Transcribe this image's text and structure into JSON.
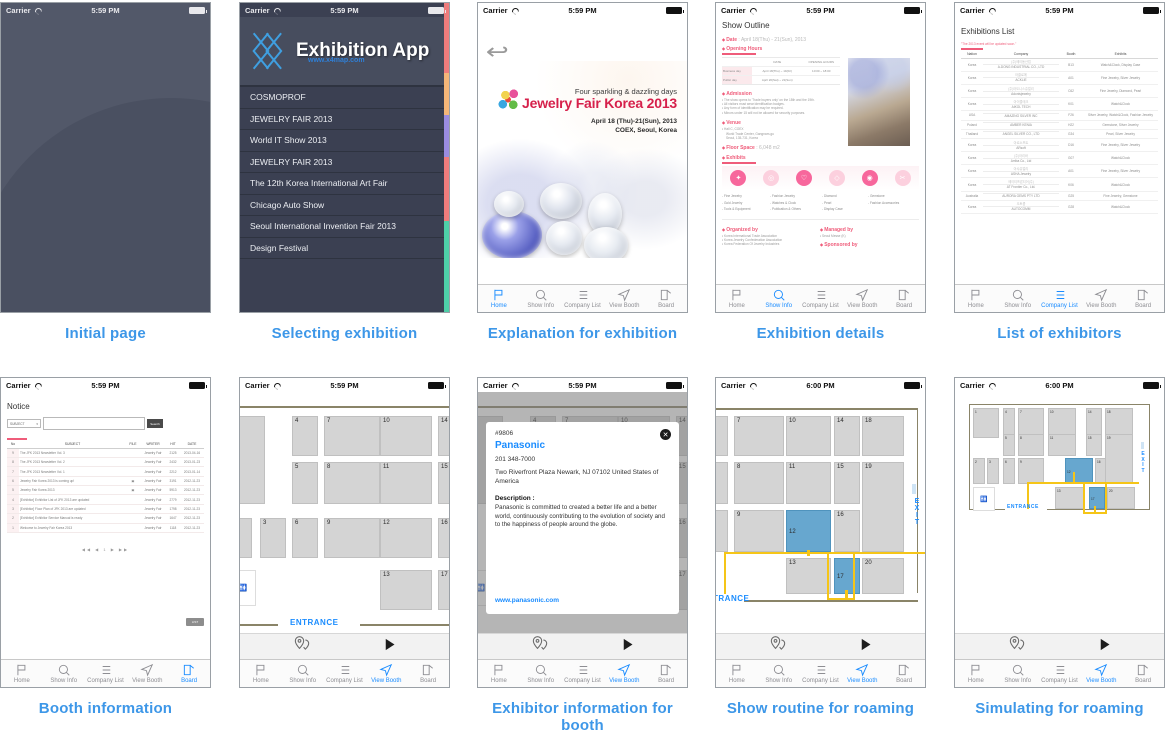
{
  "status_bar": {
    "carrier": "Carrier",
    "time_559": "5:59 PM",
    "time_600": "6:00 PM"
  },
  "tabs": [
    {
      "label": "Home",
      "icon": "flag-icon"
    },
    {
      "label": "Show Info",
      "icon": "search-icon"
    },
    {
      "label": "Company List",
      "icon": "list-icon"
    },
    {
      "label": "View Booth",
      "icon": "navigation-arrow-icon"
    },
    {
      "label": "Board",
      "icon": "compose-icon"
    }
  ],
  "panels": [
    {
      "caption": "Initial page"
    },
    {
      "caption": "Selecting exhibition"
    },
    {
      "caption": "Explanation for exhibition"
    },
    {
      "caption": "Exhibition details"
    },
    {
      "caption": "List of exhibitors"
    },
    {
      "caption": "Booth information"
    },
    {
      "caption": ""
    },
    {
      "caption": "Exhibitor information for booth"
    },
    {
      "caption": "Show routine for roaming"
    },
    {
      "caption": "Simulating for roaming"
    }
  ],
  "splash": {
    "title_line1": "Exhibition",
    "title_line2": "App",
    "website": "www.x4map.com"
  },
  "exhibition_list": {
    "header_title": "Exhibition App",
    "header_sub": "www.x4map.com",
    "items": [
      "COSMOPROF",
      "JEWELRY FAIR 2013",
      "World IT Show 2013",
      "JEWELRY FAIR 2013",
      "The 12th Korea International Art Fair",
      "Chicago Auto Show",
      "Seoul International Invention Fair 2013",
      "Design Festival"
    ],
    "scroll_colors": [
      "#ef7c7c",
      "#f5b678",
      "#9b8ce0",
      "#ef7c7c",
      "#4ecfa8"
    ]
  },
  "poster": {
    "tagline": "Four sparkling & dazzling days",
    "title": "Jewelry Fair Korea 2013",
    "dates": "April 18 (Thu)-21(Sun), 2013",
    "venue": "COEX, Seoul, Korea",
    "back_icon": "back-arrow-icon"
  },
  "show_outline": {
    "title": "Show Outline",
    "sections": [
      {
        "label": "Date",
        "value": "April 18(Thu) - 21(Sun), 2013"
      },
      {
        "label": "Opening Hours",
        "value": ""
      },
      {
        "label": "Admission",
        "value": ""
      },
      {
        "label": "Venue",
        "value": ""
      },
      {
        "label": "Floor Space",
        "value": "6,048 m2"
      },
      {
        "label": "Exhibits",
        "value": ""
      },
      {
        "label": "Organized by",
        "value": ""
      },
      {
        "label": "Managed by",
        "value": ""
      },
      {
        "label": "Sponsored by",
        "value": ""
      }
    ],
    "hours_table": {
      "headers": [
        "DATE",
        "OPENING HOURS"
      ],
      "rows": [
        [
          "Business day",
          "April 18(Thu) ~ 19(Fri)",
          "10:00 ~ 18:00"
        ],
        [
          "Public day",
          "April 20(Sat) ~ 21(Sun)",
          ""
        ]
      ]
    },
    "admission_bullets": [
      "The show opens to 'Trade buyers only' on the 18th and the 19th.",
      "All visitors must wear identification badges.",
      "Any form of identification may be required.",
      "Minors under 15 will not be allowed for security purposes."
    ],
    "venue_lines": [
      "Hall C, COEX",
      "World Trade Center, Gangnam-gu",
      "Seoul, 135-731, Korea"
    ],
    "exhibit_categories": [
      "Fine Jewelry",
      "Fashion Jewelry",
      "Diamond",
      "Gemstone",
      "Gold Jewelry",
      "Watches & Clock",
      "Pearl",
      "Fashion Accessories",
      "Tools & Equipment",
      "Publication & Others",
      "Display Case"
    ],
    "organizers": [
      "Korea International Trade Association",
      "Korea Jewelry Confederation Association",
      "Korea Federation Of Jewelry Industries"
    ],
    "managers": [
      "Seoul Messe (K)"
    ]
  },
  "exhibitors": {
    "title": "Exhibitions List",
    "note": "\"The 2013 event will be updated soon.\"",
    "headers": [
      "Nation",
      "Company",
      "Booth",
      "Exhibits"
    ],
    "rows": [
      {
        "nation": "Korea",
        "ko": "(주)에이동산업",
        "company": "A-DONG INDUSTRIAL CO., LTD",
        "booth": "B13",
        "exhibits": "Watch&Clock, Display Case"
      },
      {
        "nation": "Korea",
        "ko": "아클로에",
        "company": "ACKLIE",
        "booth": "A01",
        "exhibits": "Fine Jewelry, Silver Jewelry"
      },
      {
        "nation": "Korea",
        "ko": "(주)아도니스쥬얼리",
        "company": "Adonisjewelry",
        "booth": "C62",
        "exhibits": "Fine Jewelry, Diamond, Pearl"
      },
      {
        "nation": "Korea",
        "ko": "아이콜테크",
        "company": "AIKOL TECH",
        "booth": "K01",
        "exhibits": "Watch&Clock"
      },
      {
        "nation": "USA",
        "ko": "",
        "company": "AMAZING SILVER INC",
        "booth": "F26",
        "exhibits": "Silver Jewelry, Watch&Clock, Fashion Jewelry"
      },
      {
        "nation": "Poland",
        "ko": "",
        "company": "AMBER KENIA",
        "booth": "H22",
        "exhibits": "Gemstone, Silver Jewelry"
      },
      {
        "nation": "Thailand",
        "ko": "",
        "company": "ANGEL SILVER CO., LTD",
        "booth": "G34",
        "exhibits": "Pearl, Silver Jewelry"
      },
      {
        "nation": "Korea",
        "ko": "아르소프트",
        "company": "ARsoft",
        "booth": "D16",
        "exhibits": "Fine Jewelry, Silver Jewelry"
      },
      {
        "nation": "Korea",
        "ko": "(주)아리바",
        "company": "Arriba Co., Ltd",
        "booth": "G07",
        "exhibits": "Watch&Clock"
      },
      {
        "nation": "Korea",
        "ko": "아샤쥬얼리",
        "company": "ASHA Jewelry",
        "booth": "A01",
        "exhibits": "Fine Jewelry, Silver Jewelry"
      },
      {
        "nation": "Korea",
        "ko": "에이티프론티어(주)",
        "company": "AT Frontier Co., Ltd.",
        "booth": "K06",
        "exhibits": "Watch&Clock"
      },
      {
        "nation": "Australia",
        "ko": "",
        "company": "AURORA GEMS PTY LTD",
        "booth": "G25",
        "exhibits": "Fine Jewelry, Gemstone"
      },
      {
        "nation": "Korea",
        "ko": "오토콤",
        "company": "AUTOCOMM",
        "booth": "G28",
        "exhibits": "Watch&Clock"
      }
    ]
  },
  "notice": {
    "title": "Notice",
    "search_select": "SUBJECT",
    "search_value": "",
    "search_button": "Search",
    "headers": [
      "No",
      "SUBJECT",
      "FILE",
      "WRITER",
      "HIT",
      "DATE"
    ],
    "rows": [
      {
        "no": "9",
        "subject": "The JFK 2013 Newsletter Vol. 3",
        "file": "",
        "writer": "Jewelry Fair",
        "hit": "2125",
        "date": "2013-04-16"
      },
      {
        "no": "8",
        "subject": "The JFK 2013 Newsletter Vol. 2",
        "file": "",
        "writer": "Jewelry Fair",
        "hit": "2432",
        "date": "2013-01-23"
      },
      {
        "no": "7",
        "subject": "The JFK 2013 Newsletter Vol. 1",
        "file": "",
        "writer": "Jewelry Fair",
        "hit": "2212",
        "date": "2013-01-14"
      },
      {
        "no": "6",
        "subject": "Jewelry Fair Korea 2013 is coming up!",
        "file": "attachment-icon",
        "writer": "Jewelry Fair",
        "hit": "3191",
        "date": "2012-11-23"
      },
      {
        "no": "5",
        "subject": "Jewelry Fair Korea 2013",
        "file": "attachment-icon",
        "writer": "Jewelry Fair",
        "hit": "5913",
        "date": "2012-11-23"
      },
      {
        "no": "4",
        "subject": "[Exhibitor] Exhibitor List of JFK 2013 are updated",
        "file": "",
        "writer": "Jewelry Fair",
        "hit": "2779",
        "date": "2012-11-23"
      },
      {
        "no": "3",
        "subject": "[Exhibitor] Floor Plan of JFK 2013 are updated",
        "file": "",
        "writer": "Jewelry Fair",
        "hit": "1798",
        "date": "2012-11-23"
      },
      {
        "no": "2",
        "subject": "[Exhibitor] Exhibitor Service Manual is ready",
        "file": "",
        "writer": "Jewelry Fair",
        "hit": "1647",
        "date": "2012-11-23"
      },
      {
        "no": "1",
        "subject": "Welcome to Jewelry Fair Korea 2013",
        "file": "",
        "writer": "Jewelry Fair",
        "hit": "1118",
        "date": "2012-11-23"
      }
    ],
    "pager": "◀◀ ◀ 1 ▶ ▶▶",
    "list_button": "LIST"
  },
  "booth_popup": {
    "number": "#9806",
    "name": "Panasonic",
    "phone": "201 348-7000",
    "address": "Two Riverfront Plaza Newark, NJ 07102 United States of America",
    "description_label": "Description :",
    "description": "Panasonic is committed to created a better life and a better world, continuously contributing to the evolution of society and to the happiness of people around the globe.",
    "website": "www.panasonic.com",
    "close_icon": "close-icon"
  },
  "map": {
    "entrance_label": "ENTRANCE",
    "entrance_label_partial": "TRANCE",
    "exit_label": "EXIT",
    "selected_booths": [
      "12",
      "17"
    ],
    "route_color": "#f5c518",
    "selected_color": "#67a7cf",
    "booth_numbers_zoomed": [
      "3",
      "4",
      "5",
      "6",
      "7",
      "8",
      "9",
      "10",
      "11",
      "12",
      "13",
      "14",
      "15",
      "16",
      "17"
    ],
    "booth_numbers_full": [
      "1",
      "2",
      "3",
      "4",
      "5",
      "6",
      "7",
      "8",
      "9",
      "10",
      "11",
      "12",
      "13",
      "14",
      "15",
      "16",
      "17",
      "18",
      "19",
      "20"
    ],
    "wc_icon": "restroom-icon",
    "pin_icon": "map-pin-icon",
    "play_icon": "play-icon"
  },
  "accent_colors": {
    "link_blue": "#1a8cff",
    "caption_blue": "#3d97e8",
    "pink": "#ef5c7a",
    "route_yellow": "#f5c518"
  }
}
